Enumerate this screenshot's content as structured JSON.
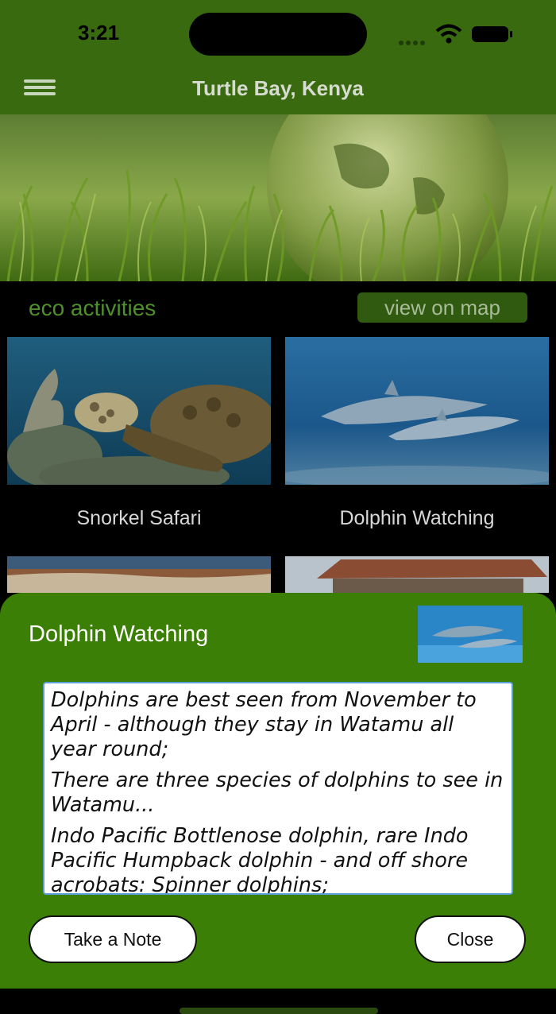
{
  "status_bar": {
    "time": "3:21"
  },
  "nav": {
    "title": "Turtle Bay, Kenya",
    "menu_icon": "hamburger-menu-icon"
  },
  "section": {
    "title": "eco activities",
    "map_button": "view on map"
  },
  "activities": [
    {
      "label": "Snorkel Safari"
    },
    {
      "label": "Dolphin Watching"
    }
  ],
  "sheet": {
    "title": "Dolphin Watching",
    "paragraphs": [
      "Dolphins are best seen from November to April - although they stay in Watamu all year round;",
      "There are three species of dolphins to see in Watamu...",
      "Indo Pacific Bottlenose dolphin, rare Indo Pacific Humpback dolphin - and off shore acrobats: Spinner dolphins;"
    ],
    "note_button": "Take a Note",
    "close_button": "Close"
  },
  "colors": {
    "header_green": "#3a6a0f",
    "sheet_green": "#3b7f06",
    "accent_green": "#4f8f2c"
  }
}
